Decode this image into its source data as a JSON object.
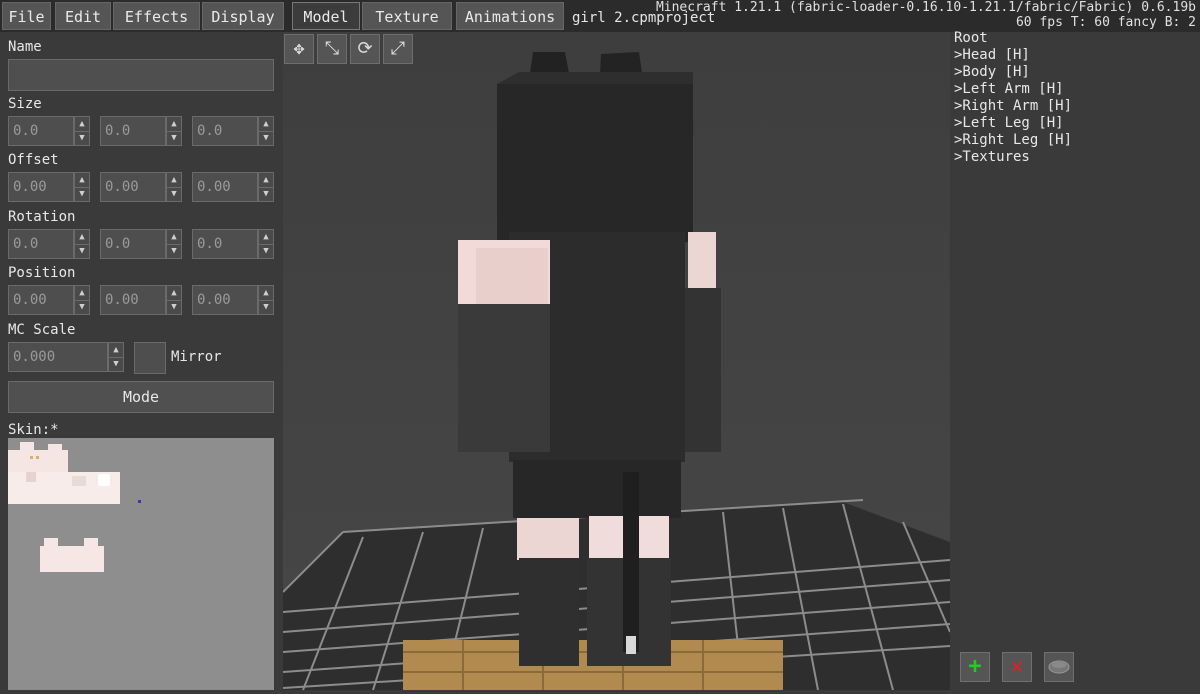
{
  "menu": {
    "file": "File",
    "edit": "Edit",
    "effects": "Effects",
    "display": "Display",
    "model": "Model",
    "texture": "Texture",
    "animations": "Animations"
  },
  "project_title": "girl 2.cpmproject",
  "debug": {
    "line1": "Minecraft 1.21.1 (fabric-loader-0.16.10-1.21.1/fabric/Fabric) 0.6.19b",
    "line2": "60 fps T: 60 fancy B: 2"
  },
  "properties": {
    "name_label": "Name",
    "size_label": "Size",
    "size": [
      "0.0",
      "0.0",
      "0.0"
    ],
    "offset_label": "Offset",
    "offset": [
      "0.00",
      "0.00",
      "0.00"
    ],
    "rotation_label": "Rotation",
    "rotation": [
      "0.0",
      "0.0",
      "0.0"
    ],
    "position_label": "Position",
    "position": [
      "0.00",
      "0.00",
      "0.00"
    ],
    "mcscale_label": "MC Scale",
    "mcscale": "0.000",
    "mirror_label": "Mirror",
    "mode_label": "Mode",
    "skin_label": "Skin:*"
  },
  "tree": {
    "root": "Root",
    "items": [
      ">Head [H]",
      ">Body [H]",
      ">Left Arm [H]",
      ">Right Arm [H]",
      ">Left Leg [H]",
      ">Right Leg [H]",
      ">Textures"
    ]
  },
  "icons": {
    "move": "move-icon",
    "scale": "scale-icon",
    "rotate": "rotate-icon",
    "size": "size-icon",
    "add": "plus-icon",
    "delete": "x-icon",
    "visibility": "eye-icon"
  },
  "colors": {
    "add": "#22cc22",
    "delete": "#e02020"
  }
}
